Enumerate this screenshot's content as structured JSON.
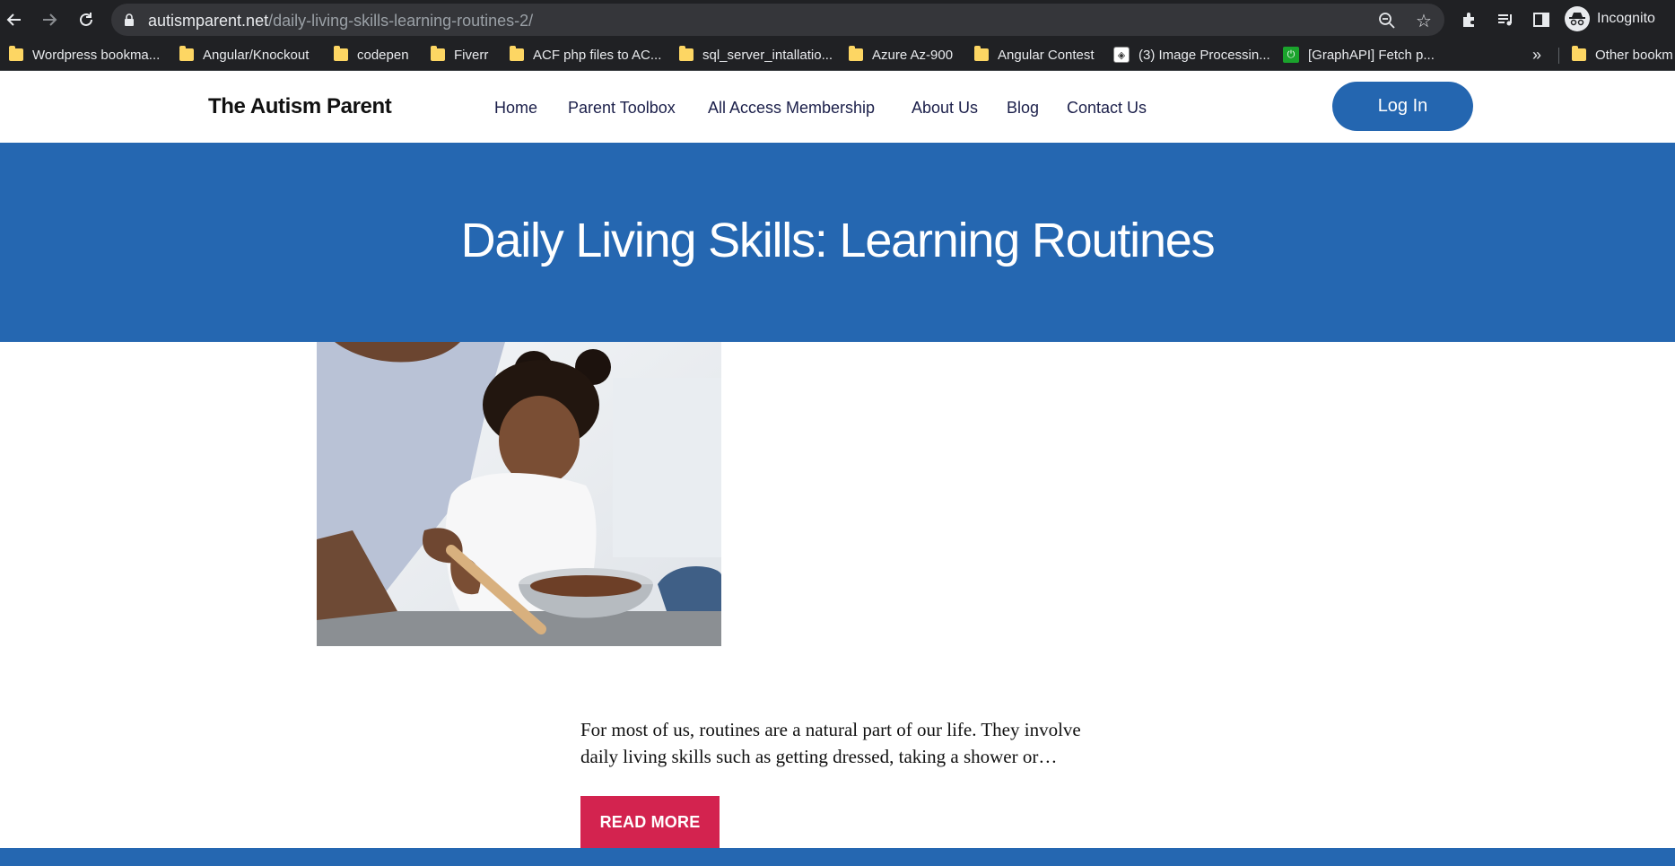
{
  "browser": {
    "url_host": "autismparent.net",
    "url_path": "/daily-living-skills-learning-routines-2/",
    "profile_label": "Incognito",
    "bookmarks": [
      {
        "label": "Wordpress bookma...",
        "icon": "folder-icon"
      },
      {
        "label": "Angular/Knockout",
        "icon": "folder-icon"
      },
      {
        "label": "codepen",
        "icon": "folder-icon"
      },
      {
        "label": "Fiverr",
        "icon": "folder-icon"
      },
      {
        "label": "ACF php files to AC...",
        "icon": "folder-icon"
      },
      {
        "label": "sql_server_intallatio...",
        "icon": "folder-icon"
      },
      {
        "label": "Azure Az-900",
        "icon": "folder-icon"
      },
      {
        "label": "Angular Contest",
        "icon": "folder-icon"
      },
      {
        "label": "(3) Image Processin...",
        "icon": "site-favicon"
      },
      {
        "label": "[GraphAPI] Fetch p...",
        "icon": "site-favicon"
      }
    ],
    "more_label": "»",
    "other_bookmarks": "Other bookm"
  },
  "site": {
    "logo": "The Autism Parent",
    "nav": [
      "Home",
      "Parent Toolbox",
      "All Access Membership",
      "About Us",
      "Blog",
      "Contact Us"
    ],
    "login_label": "Log In"
  },
  "hero": {
    "title": "Daily Living Skills: Learning Routines"
  },
  "post": {
    "excerpt_line1": "For most of us, routines are a natural part of our life. They involve",
    "excerpt_line2": "daily living skills such as getting dressed, taking a shower or…",
    "read_more": "READ MORE"
  },
  "colors": {
    "brand_blue": "#2567b1",
    "accent_red": "#d3234f",
    "chrome_dark": "#202124"
  }
}
